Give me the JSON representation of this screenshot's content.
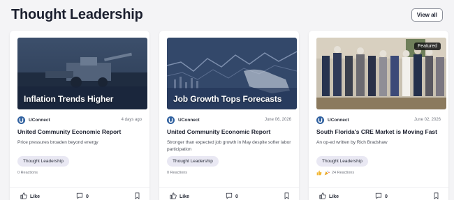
{
  "section": {
    "title": "Thought Leadership",
    "view_all_label": "View all"
  },
  "cards": [
    {
      "image_caption": "Inflation Trends Higher",
      "author": "UConnect",
      "date": "4 days ago",
      "title": "United Community Economic Report",
      "summary": "Price pressures broaden beyond energy",
      "tag": "Thought Leadership",
      "reactions": "0 Reactions",
      "like_label": "Like",
      "comment_count": "0"
    },
    {
      "image_caption": "Job Growth Tops Forecasts",
      "author": "UConnect",
      "date": "June 06, 2026",
      "title": "United Community Economic Report",
      "summary": "Stronger than expected job growth in May despite softer labor participation",
      "tag": "Thought Leadership",
      "reactions": "0 Reactions",
      "like_label": "Like",
      "comment_count": "0"
    },
    {
      "badge": "Featured",
      "author": "UConnect",
      "date": "June 02, 2026",
      "title": "South Florida's CRE Market is Moving Fast",
      "summary": "An op-ed written by Rich Bradshaw",
      "tag": "Thought Leadership",
      "reactions": "24 Reactions",
      "like_label": "Like",
      "comment_count": "0"
    }
  ],
  "icons": {
    "logo": "uconnect-logo-icon",
    "like": "thumbs-up-icon",
    "comment": "comment-icon",
    "save": "bookmark-icon",
    "reaction_emojis": [
      "thumbs-up-emoji",
      "celebrate-emoji"
    ]
  },
  "colors": {
    "brand": "#2e5f9e",
    "tag_bg": "#e9e8f3",
    "page_bg": "#f4f4f6"
  }
}
